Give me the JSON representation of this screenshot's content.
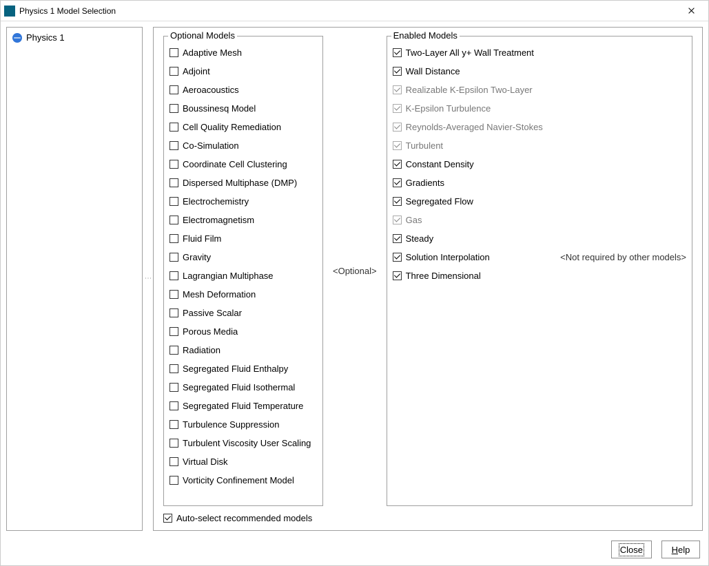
{
  "window": {
    "title": "Physics 1 Model Selection"
  },
  "tree": {
    "root_label": "Physics 1"
  },
  "groups": {
    "optional_legend": "Optional Models",
    "enabled_legend": "Enabled Models",
    "separator_label": "<Optional>"
  },
  "optional_models": [
    {
      "label": "Adaptive Mesh",
      "checked": false
    },
    {
      "label": "Adjoint",
      "checked": false
    },
    {
      "label": "Aeroacoustics",
      "checked": false
    },
    {
      "label": "Boussinesq Model",
      "checked": false
    },
    {
      "label": "Cell Quality Remediation",
      "checked": false
    },
    {
      "label": "Co-Simulation",
      "checked": false
    },
    {
      "label": "Coordinate Cell Clustering",
      "checked": false
    },
    {
      "label": "Dispersed Multiphase (DMP)",
      "checked": false
    },
    {
      "label": "Electrochemistry",
      "checked": false
    },
    {
      "label": "Electromagnetism",
      "checked": false
    },
    {
      "label": "Fluid Film",
      "checked": false
    },
    {
      "label": "Gravity",
      "checked": false
    },
    {
      "label": "Lagrangian Multiphase",
      "checked": false
    },
    {
      "label": "Mesh Deformation",
      "checked": false
    },
    {
      "label": "Passive Scalar",
      "checked": false
    },
    {
      "label": "Porous Media",
      "checked": false
    },
    {
      "label": "Radiation",
      "checked": false
    },
    {
      "label": "Segregated Fluid Enthalpy",
      "checked": false
    },
    {
      "label": "Segregated Fluid Isothermal",
      "checked": false
    },
    {
      "label": "Segregated Fluid Temperature",
      "checked": false
    },
    {
      "label": "Turbulence Suppression",
      "checked": false
    },
    {
      "label": "Turbulent Viscosity User Scaling",
      "checked": false
    },
    {
      "label": "Virtual Disk",
      "checked": false
    },
    {
      "label": "Vorticity Confinement Model",
      "checked": false
    }
  ],
  "enabled_models": [
    {
      "label": "Two-Layer All y+ Wall Treatment",
      "checked": true,
      "disabled": false
    },
    {
      "label": "Wall Distance",
      "checked": true,
      "disabled": false
    },
    {
      "label": "Realizable K-Epsilon Two-Layer",
      "checked": true,
      "disabled": true
    },
    {
      "label": "K-Epsilon Turbulence",
      "checked": true,
      "disabled": true
    },
    {
      "label": "Reynolds-Averaged Navier-Stokes",
      "checked": true,
      "disabled": true
    },
    {
      "label": "Turbulent",
      "checked": true,
      "disabled": true
    },
    {
      "label": "Constant Density",
      "checked": true,
      "disabled": false
    },
    {
      "label": "Gradients",
      "checked": true,
      "disabled": false
    },
    {
      "label": "Segregated Flow",
      "checked": true,
      "disabled": false
    },
    {
      "label": "Gas",
      "checked": true,
      "disabled": true
    },
    {
      "label": "Steady",
      "checked": true,
      "disabled": false
    },
    {
      "label": "Solution Interpolation",
      "checked": true,
      "disabled": false,
      "note": "<Not required by other models>"
    },
    {
      "label": "Three Dimensional",
      "checked": true,
      "disabled": false
    }
  ],
  "auto_select": {
    "label": "Auto-select recommended models",
    "checked": true
  },
  "buttons": {
    "close": "Close",
    "help": "Help"
  }
}
